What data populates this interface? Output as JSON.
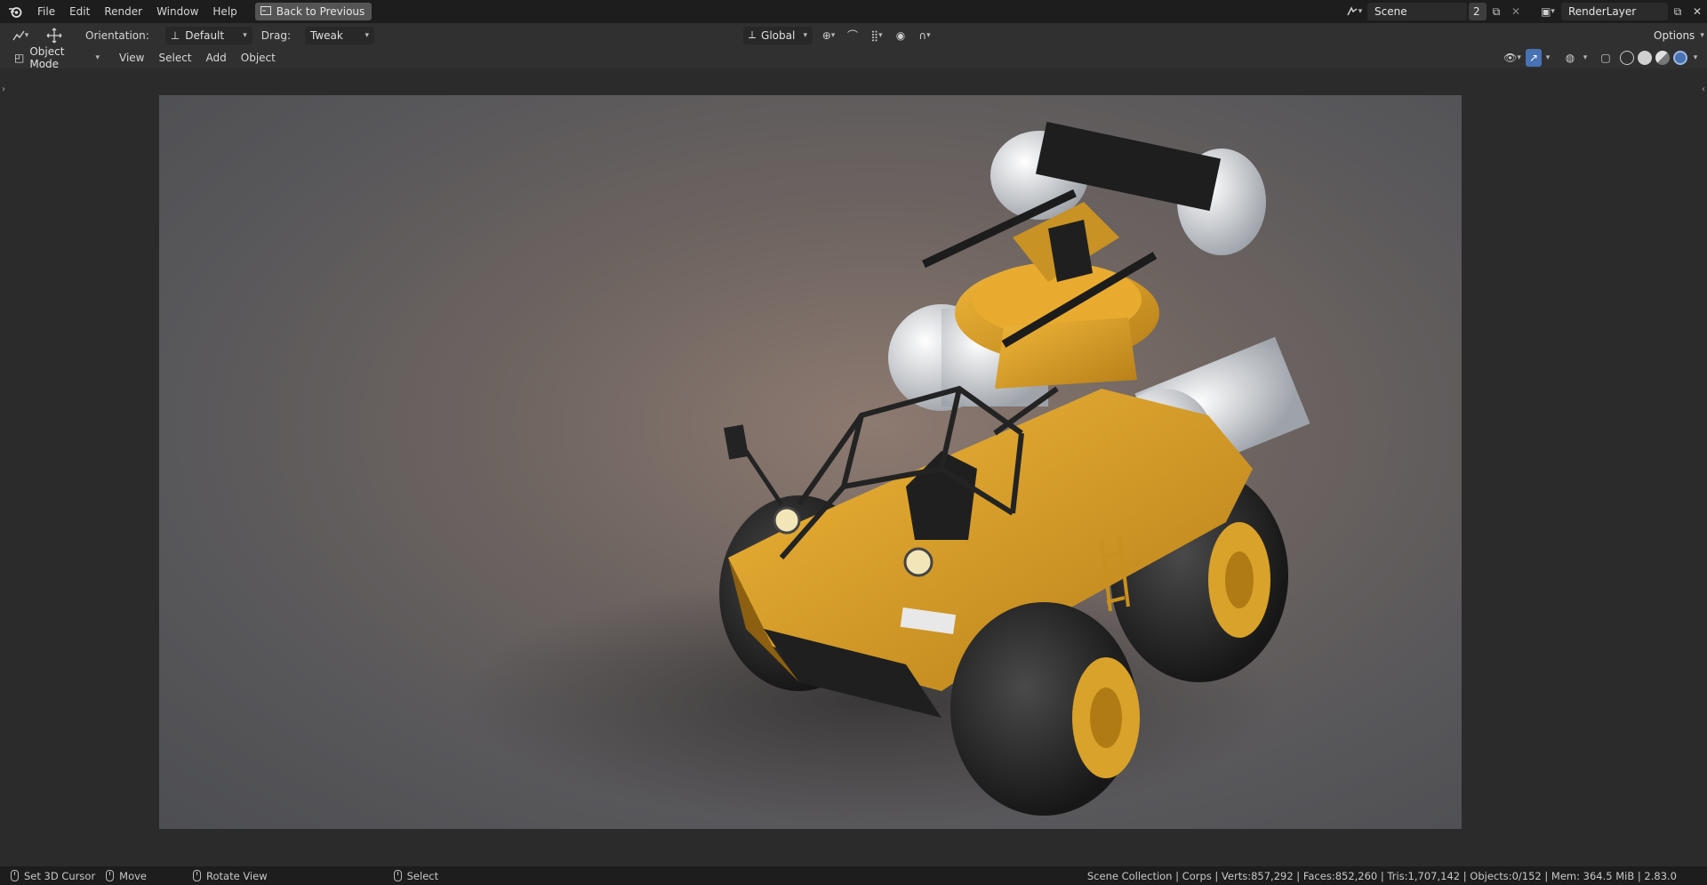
{
  "topbar": {
    "menus": [
      "File",
      "Edit",
      "Render",
      "Window",
      "Help"
    ],
    "back_button": "Back to Previous",
    "scene_name": "Scene",
    "scene_users": "2",
    "render_layer": "RenderLayer"
  },
  "tool_header": {
    "orientation_label": "Orientation:",
    "orientation_value": "Default",
    "drag_label": "Drag:",
    "drag_value": "Tweak",
    "transform_orientation": "Global",
    "options_label": "Options"
  },
  "viewport_header": {
    "mode": "Object Mode",
    "menus": [
      "View",
      "Select",
      "Add",
      "Object"
    ]
  },
  "statusbar": {
    "items": [
      {
        "label": "Set 3D Cursor"
      },
      {
        "label": "Move"
      },
      {
        "label": "Rotate View"
      },
      {
        "label": "Select"
      }
    ],
    "stats": "Scene Collection | Corps | Verts:857,292 | Faces:852,260 | Tris:1,707,142 | Objects:0/152 | Mem: 364.5 MiB | 2.83.0"
  },
  "colors": {
    "vehicle_body": "#d9a22a",
    "tire": "#2b2b2b",
    "tank": "#e8e8e8",
    "accent_blue": "#4772b3"
  }
}
